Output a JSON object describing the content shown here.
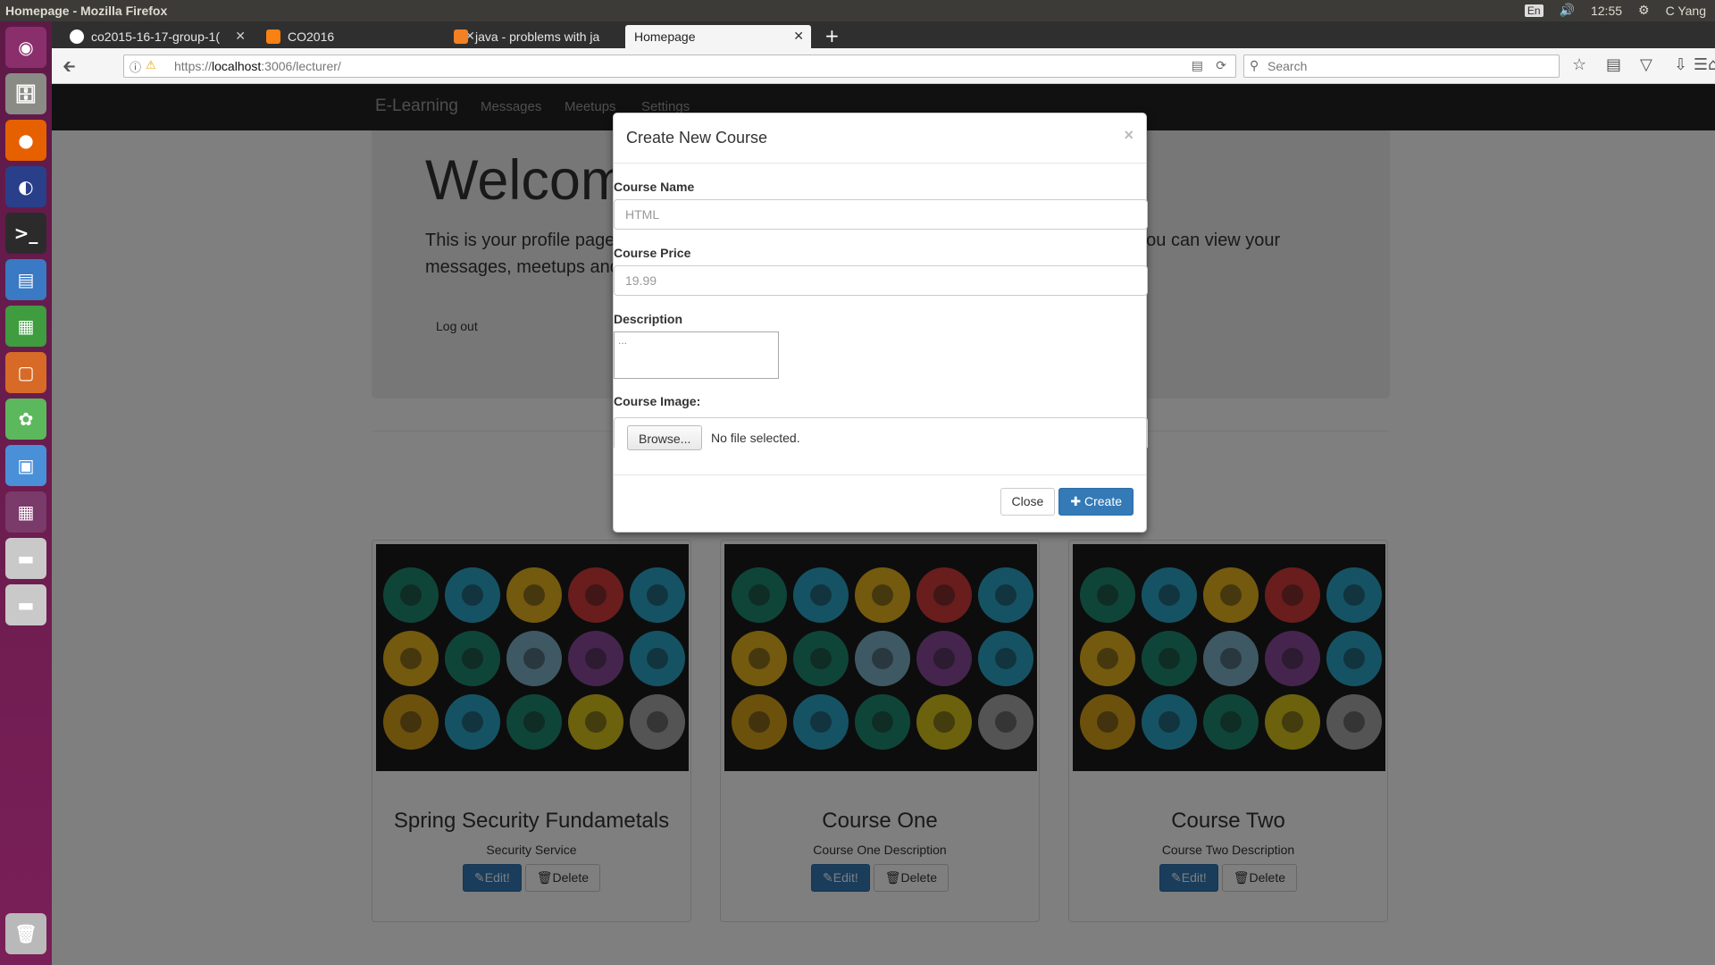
{
  "os_bar": {
    "window_title": "Homepage - Mozilla Firefox",
    "keyboard": "En",
    "clock": "12:55",
    "user": "C Yang"
  },
  "browser": {
    "tabs": [
      {
        "label": "co2015-16-17-group-1(",
        "favicon": "github-icon",
        "active": false
      },
      {
        "label": "CO2016",
        "favicon": "moodle-icon",
        "active": false
      },
      {
        "label": "java - problems with ja",
        "favicon": "stackoverflow-icon",
        "active": false
      },
      {
        "label": "Homepage",
        "favicon": "none",
        "active": true
      }
    ],
    "url_prefix": "https://",
    "url_host": "localhost",
    "url_path": ":3006/lecturer/",
    "search_placeholder": "Search"
  },
  "app": {
    "brand": "E-Learning",
    "nav": [
      "Messages",
      "Meetups",
      "Settings"
    ],
    "welcome_title": "Welcome",
    "welcome_text": "This is your profile page. Here you can view, add, edit and delete the courses. Also above you can view your messages, meetups and settings such as your details and you can add more.",
    "logout_label": "Log out"
  },
  "courses": [
    {
      "title": "Spring Security Fundametals",
      "description": "Security Service",
      "edit_label": "Edit!",
      "delete_label": "Delete"
    },
    {
      "title": "Course One",
      "description": "Course One Description",
      "edit_label": "Edit!",
      "delete_label": "Delete"
    },
    {
      "title": "Course Two",
      "description": "Course Two Description",
      "edit_label": "Edit!",
      "delete_label": "Delete"
    }
  ],
  "modal": {
    "title": "Create New Course",
    "close_x": "×",
    "course_name_label": "Course Name",
    "course_name_placeholder": "HTML",
    "course_price_label": "Course Price",
    "course_price_placeholder": "19.99",
    "description_label": "Description",
    "description_placeholder": "...",
    "image_label": "Course Image:",
    "browse_label": "Browse...",
    "no_file_label": "No file selected.",
    "close_label": "Close",
    "create_label": "Create"
  },
  "colors": {
    "primary": "#337ab7",
    "navbar": "#222222",
    "launcher": "#6b1d50"
  }
}
